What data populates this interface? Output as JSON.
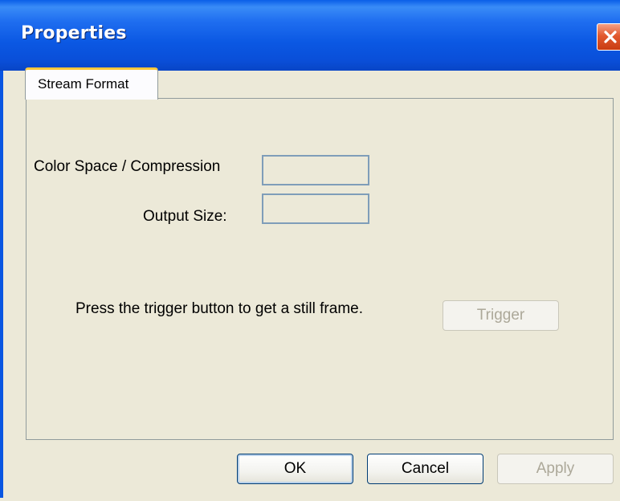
{
  "window": {
    "title": "Properties",
    "close_icon": "close-icon"
  },
  "tabs": [
    {
      "label": "Stream Format",
      "selected": true
    }
  ],
  "stream_format": {
    "color_space_label": "Color Space / Compression",
    "color_space_value": "",
    "output_size_label": "Output Size:",
    "output_size_value": "",
    "trigger_text": "Press the trigger button to get a still frame.",
    "trigger_button": "Trigger",
    "trigger_enabled": false
  },
  "buttons": {
    "ok": "OK",
    "cancel": "Cancel",
    "apply": "Apply",
    "apply_enabled": false
  },
  "colors": {
    "titlebar": "#0a5ee8",
    "dialog_bg": "#ece9d8",
    "tab_accent": "#ffc83c",
    "close_button": "#e2592e"
  }
}
